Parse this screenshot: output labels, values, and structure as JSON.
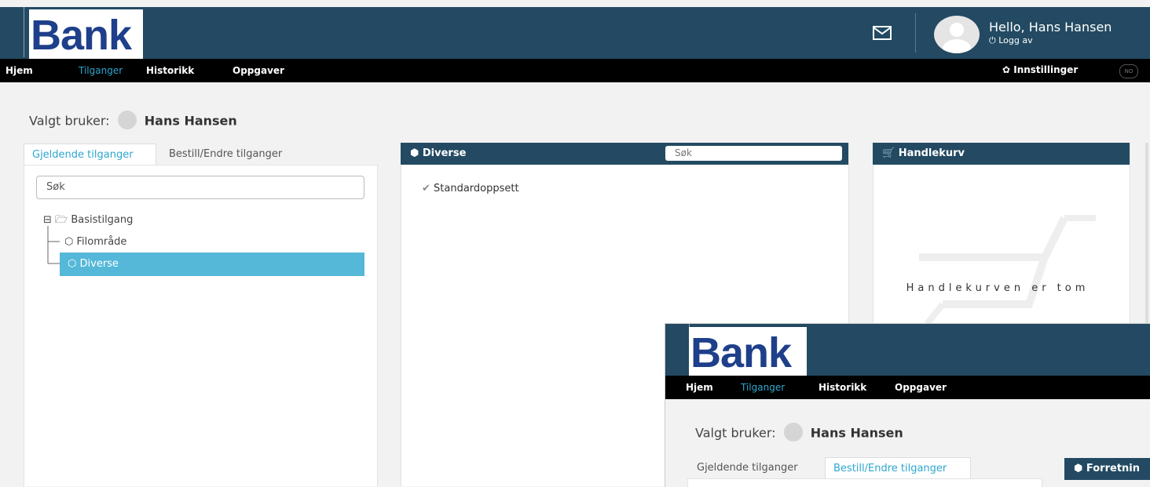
{
  "app": {
    "logo": "Bank"
  },
  "header": {
    "greeting": "Hello, Hans Hansen",
    "logout": "Logg av"
  },
  "nav": {
    "items": [
      "Hjem",
      "Tilganger",
      "Historikk",
      "Oppgaver"
    ],
    "active": "Tilganger",
    "settings": "Innstillinger",
    "language": "NO"
  },
  "user": {
    "label": "Valgt bruker:",
    "name": "Hans Hansen"
  },
  "tabs": [
    "Gjeldende tilganger",
    "Bestill/Endre tilganger"
  ],
  "tree": {
    "search_placeholder": "Søk",
    "root": "Basistilgang",
    "children": [
      "Filområde",
      "Diverse"
    ],
    "selected": "Diverse"
  },
  "diverse_card": {
    "title": "Diverse",
    "search_placeholder": "Søk",
    "items": [
      "Standardoppsett"
    ]
  },
  "cart": {
    "title": "Handlekurv",
    "empty_text": "Handlekurven er tom"
  },
  "overlay": {
    "card_title_partial": "Forretnin"
  }
}
